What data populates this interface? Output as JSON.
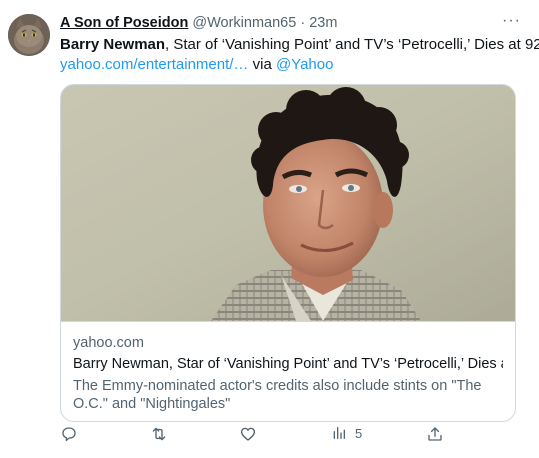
{
  "author": {
    "name": "A Son of Poseidon",
    "handle": "@Workinman65",
    "separator": "·",
    "time": "23m"
  },
  "menu": {
    "more_label": "···"
  },
  "tweet": {
    "headline_bold": "Barry Newman",
    "headline_rest": ", Star of ‘Vanishing Point’ and TV’s ‘Petrocelli,’ Dies at 92",
    "link_text": "yahoo.com/entertainment/…",
    "via_text": " via ",
    "via_handle": "@Yahoo"
  },
  "card": {
    "domain": "yahoo.com",
    "title": "Barry Newman, Star of ‘Vanishing Point’ and TV’s ‘Petrocelli,’ Dies at…",
    "description": "The Emmy-nominated actor's credits also include stints on \"The O.C.\" and \"Nightingales\"",
    "image_icon": "actor-portrait-photo"
  },
  "actions": {
    "reply_icon": "reply-icon",
    "retweet_icon": "retweet-icon",
    "like_icon": "heart-icon",
    "views_icon": "analytics-icon",
    "views_count": "5",
    "share_icon": "share-icon"
  },
  "colors": {
    "link": "#1d9bf0",
    "muted": "#536471",
    "border": "#cfd9de",
    "text": "#0f1419"
  }
}
